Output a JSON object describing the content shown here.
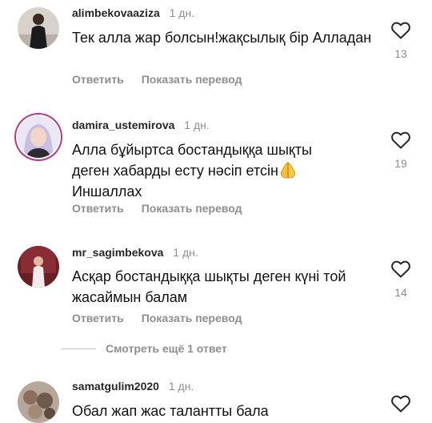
{
  "comments": [
    {
      "username": "alimbekovaaziza",
      "time": "1 дн.",
      "text": "Тек алла жар болсын!жақсылық бір Алладан",
      "reply_label": "Ответить",
      "translate_label": "Показать перевод",
      "likes": "13"
    },
    {
      "username": "damira_ustemirova",
      "time": "1 дн.",
      "text_line1": "Алла бұйыртса бостандыққа шықты",
      "text_line2": "деген хабарды есту нәсіп етсін",
      "text_line3": "Иншаллах",
      "emoji": "folded-hands-emoji",
      "reply_label": "Ответить",
      "translate_label": "Показать перевод",
      "likes": "19"
    },
    {
      "username": "mr_sagimbekova",
      "time": "1 дн.",
      "text": "Асқар бостандыққа шықты деген күні той жасаймын балам",
      "reply_label": "Ответить",
      "translate_label": "Показать перевод",
      "likes": "14"
    },
    {
      "username": "samatgulim2020",
      "time": "1 дн.",
      "text": "Обал жап жас талантты бала"
    }
  ],
  "more_replies_label": "Смотреть ещё 1 ответ",
  "icons": {
    "like": "heart-outline-icon"
  },
  "colors": {
    "username": "#262626",
    "secondary": "#8e8e8e",
    "story_ring": "#c13584"
  }
}
